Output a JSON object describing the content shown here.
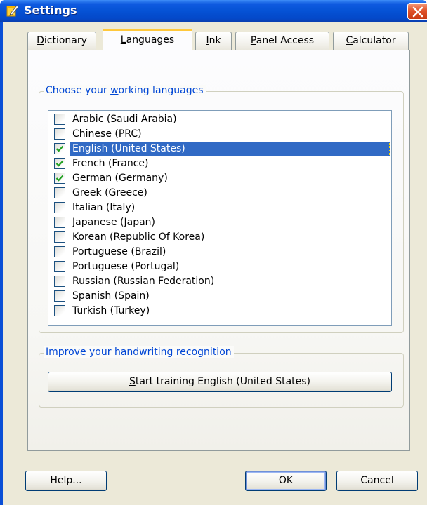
{
  "window": {
    "title": "Settings"
  },
  "tabs": [
    {
      "label": "Dictionary",
      "accel": "D",
      "rest": "ictionary",
      "active": false
    },
    {
      "label": "Languages",
      "accel": "L",
      "rest": "anguages",
      "active": true
    },
    {
      "label": "Ink",
      "accel": "I",
      "rest": "nk",
      "active": false
    },
    {
      "label": "Panel Access",
      "accel": "P",
      "rest": "anel Access",
      "active": false
    },
    {
      "label": "Calculator",
      "accel": "C",
      "rest": "alculator",
      "active": false
    }
  ],
  "languages_group": {
    "legend_before": "Choose your ",
    "legend_accel": "w",
    "legend_after": "orking languages",
    "items": [
      {
        "label": "Arabic (Saudi Arabia)",
        "checked": false,
        "selected": false
      },
      {
        "label": "Chinese (PRC)",
        "checked": false,
        "selected": false
      },
      {
        "label": "English (United States)",
        "checked": true,
        "selected": true
      },
      {
        "label": "French (France)",
        "checked": true,
        "selected": false
      },
      {
        "label": "German (Germany)",
        "checked": true,
        "selected": false
      },
      {
        "label": "Greek (Greece)",
        "checked": false,
        "selected": false
      },
      {
        "label": "Italian (Italy)",
        "checked": false,
        "selected": false
      },
      {
        "label": "Japanese (Japan)",
        "checked": false,
        "selected": false
      },
      {
        "label": "Korean (Republic Of Korea)",
        "checked": false,
        "selected": false
      },
      {
        "label": "Portuguese (Brazil)",
        "checked": false,
        "selected": false
      },
      {
        "label": "Portuguese (Portugal)",
        "checked": false,
        "selected": false
      },
      {
        "label": "Russian (Russian Federation)",
        "checked": false,
        "selected": false
      },
      {
        "label": "Spanish (Spain)",
        "checked": false,
        "selected": false
      },
      {
        "label": "Turkish (Turkey)",
        "checked": false,
        "selected": false
      }
    ]
  },
  "training_group": {
    "legend": "Improve your handwriting recognition",
    "button_accel": "S",
    "button_rest": "tart training English (United States)"
  },
  "buttons": {
    "help": "Help...",
    "ok": "OK",
    "cancel": "Cancel"
  },
  "colors": {
    "titlebar": "#0552d5",
    "selection": "#316ac5",
    "checkmark": "#21a121",
    "legend_text": "#0046d5",
    "active_tab_accent": "#ffc83c",
    "close_button": "#e0542c"
  }
}
